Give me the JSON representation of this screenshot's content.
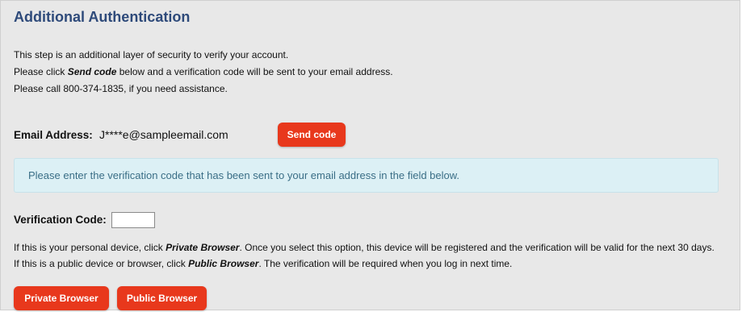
{
  "header": {
    "title": "Additional Authentication"
  },
  "intro": {
    "line1": "This step is an additional layer of security to verify your account.",
    "line2_prefix": "Please click ",
    "line2_bold": "Send code",
    "line2_suffix": " below and a verification code will be sent to your email address.",
    "line3": "Please call 800-374-1835, if you need assistance."
  },
  "email": {
    "label": "Email Address:",
    "value": "J****e@sampleemail.com",
    "send_button_label": "Send code"
  },
  "info_box": {
    "message": "Please enter the verification code that has been sent to your email address in the field below."
  },
  "verification": {
    "label": "Verification Code:",
    "value": ""
  },
  "notes": {
    "private_prefix": "If this is your personal device, click ",
    "private_bold": "Private Browser",
    "private_suffix": ". Once you select this option, this device will be registered and the verification will be valid for the next 30 days.",
    "public_prefix": "If this is a public device or browser, click ",
    "public_bold": "Public Browser",
    "public_suffix": ". The verification will be required when you log in next time."
  },
  "actions": {
    "private_button_label": "Private Browser",
    "public_button_label": "Public Browser"
  },
  "colors": {
    "title": "#2e4a7a",
    "button": "#e8381c",
    "info_background": "#dcf0f5",
    "info_text": "#3a6e86",
    "panel_background": "#e8e8e8"
  }
}
